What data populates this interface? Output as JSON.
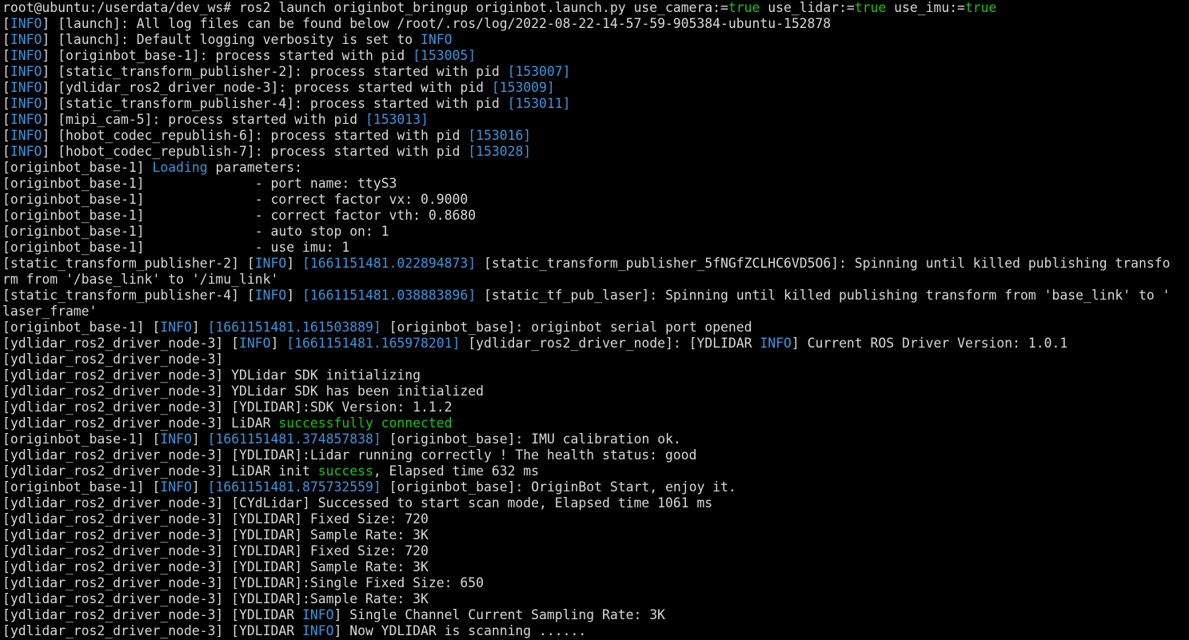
{
  "theme": {
    "background": "#000000",
    "foreground": "#d8d8d8",
    "blue": "#3a96dd",
    "green": "#16c60c"
  },
  "lines": [
    [
      [
        "d",
        "root@ubuntu:/userdata/dev_ws# ros2 launch originbot_bringup originbot.launch.py use_camera:="
      ],
      [
        "g",
        "true"
      ],
      [
        "d",
        " use_lidar:="
      ],
      [
        "g",
        "true"
      ],
      [
        "d",
        " use_imu:="
      ],
      [
        "g",
        "true"
      ]
    ],
    [
      [
        "d",
        "["
      ],
      [
        "b",
        "INFO"
      ],
      [
        "d",
        "] [launch]: All log files can be found below /root/.ros/log/2022-08-22-14-57-59-905384-ubuntu-152878"
      ]
    ],
    [
      [
        "d",
        "["
      ],
      [
        "b",
        "INFO"
      ],
      [
        "d",
        "] [launch]: Default logging verbosity is set to "
      ],
      [
        "b",
        "INFO"
      ]
    ],
    [
      [
        "d",
        "["
      ],
      [
        "b",
        "INFO"
      ],
      [
        "d",
        "] [originbot_base-1]: process started with pid "
      ],
      [
        "b",
        "[153005]"
      ]
    ],
    [
      [
        "d",
        "["
      ],
      [
        "b",
        "INFO"
      ],
      [
        "d",
        "] [static_transform_publisher-2]: process started with pid "
      ],
      [
        "b",
        "[153007]"
      ]
    ],
    [
      [
        "d",
        "["
      ],
      [
        "b",
        "INFO"
      ],
      [
        "d",
        "] [ydlidar_ros2_driver_node-3]: process started with pid "
      ],
      [
        "b",
        "[153009]"
      ]
    ],
    [
      [
        "d",
        "["
      ],
      [
        "b",
        "INFO"
      ],
      [
        "d",
        "] [static_transform_publisher-4]: process started with pid "
      ],
      [
        "b",
        "[153011]"
      ]
    ],
    [
      [
        "d",
        "["
      ],
      [
        "b",
        "INFO"
      ],
      [
        "d",
        "] [mipi_cam-5]: process started with pid "
      ],
      [
        "b",
        "[153013]"
      ]
    ],
    [
      [
        "d",
        "["
      ],
      [
        "b",
        "INFO"
      ],
      [
        "d",
        "] [hobot_codec_republish-6]: process started with pid "
      ],
      [
        "b",
        "[153016]"
      ]
    ],
    [
      [
        "d",
        "["
      ],
      [
        "b",
        "INFO"
      ],
      [
        "d",
        "] [hobot_codec_republish-7]: process started with pid "
      ],
      [
        "b",
        "[153028]"
      ]
    ],
    [
      [
        "d",
        "[originbot_base-1] "
      ],
      [
        "b",
        "Loading"
      ],
      [
        "d",
        " parameters:"
      ]
    ],
    [
      [
        "d",
        "[originbot_base-1]              - port name: ttyS3"
      ]
    ],
    [
      [
        "d",
        "[originbot_base-1]              - correct factor vx: 0.9000"
      ]
    ],
    [
      [
        "d",
        "[originbot_base-1]              - correct factor vth: 0.8680"
      ]
    ],
    [
      [
        "d",
        "[originbot_base-1]              - auto stop on: 1"
      ]
    ],
    [
      [
        "d",
        "[originbot_base-1]              - use imu: 1"
      ]
    ],
    [
      [
        "d",
        "[static_transform_publisher-2] ["
      ],
      [
        "b",
        "INFO"
      ],
      [
        "d",
        "] "
      ],
      [
        "b",
        "[1661151481.022894873]"
      ],
      [
        "d",
        " [static_transform_publisher_5fNGfZCLHC6VD5O6]: Spinning until killed publishing transfo"
      ]
    ],
    [
      [
        "d",
        "rm from '/base_link' to '/imu_link'"
      ]
    ],
    [
      [
        "d",
        "[static_transform_publisher-4] ["
      ],
      [
        "b",
        "INFO"
      ],
      [
        "d",
        "] "
      ],
      [
        "b",
        "[1661151481.038883896]"
      ],
      [
        "d",
        " [static_tf_pub_laser]: Spinning until killed publishing transform from 'base_link' to '"
      ]
    ],
    [
      [
        "d",
        "laser_frame'"
      ]
    ],
    [
      [
        "d",
        "[originbot_base-1] ["
      ],
      [
        "b",
        "INFO"
      ],
      [
        "d",
        "] "
      ],
      [
        "b",
        "[1661151481.161503889]"
      ],
      [
        "d",
        " [originbot_base]: originbot serial port opened"
      ]
    ],
    [
      [
        "d",
        "[ydlidar_ros2_driver_node-3] ["
      ],
      [
        "b",
        "INFO"
      ],
      [
        "d",
        "] "
      ],
      [
        "b",
        "[1661151481.165978201]"
      ],
      [
        "d",
        " [ydlidar_ros2_driver_node]: [YDLIDAR "
      ],
      [
        "b",
        "INFO"
      ],
      [
        "d",
        "] Current ROS Driver Version: 1.0.1"
      ]
    ],
    [
      [
        "d",
        "[ydlidar_ros2_driver_node-3]"
      ]
    ],
    [
      [
        "d",
        "[ydlidar_ros2_driver_node-3] YDLidar SDK initializing"
      ]
    ],
    [
      [
        "d",
        "[ydlidar_ros2_driver_node-3] YDLidar SDK has been initialized"
      ]
    ],
    [
      [
        "d",
        "[ydlidar_ros2_driver_node-3] [YDLIDAR]:SDK Version: 1.1.2"
      ]
    ],
    [
      [
        "d",
        "[ydlidar_ros2_driver_node-3] LiDAR "
      ],
      [
        "g",
        "successfully connected"
      ]
    ],
    [
      [
        "d",
        "[originbot_base-1] ["
      ],
      [
        "b",
        "INFO"
      ],
      [
        "d",
        "] "
      ],
      [
        "b",
        "[1661151481.374857838]"
      ],
      [
        "d",
        " [originbot_base]: IMU calibration ok."
      ]
    ],
    [
      [
        "d",
        "[ydlidar_ros2_driver_node-3] [YDLIDAR]:Lidar running correctly ! The health status: good"
      ]
    ],
    [
      [
        "d",
        "[ydlidar_ros2_driver_node-3] LiDAR init "
      ],
      [
        "g",
        "success"
      ],
      [
        "d",
        ", Elapsed time 632 ms"
      ]
    ],
    [
      [
        "d",
        "[originbot_base-1] ["
      ],
      [
        "b",
        "INFO"
      ],
      [
        "d",
        "] "
      ],
      [
        "b",
        "[1661151481.875732559]"
      ],
      [
        "d",
        " [originbot_base]: OriginBot Start, enjoy it."
      ]
    ],
    [
      [
        "d",
        "[ydlidar_ros2_driver_node-3] [CYdLidar] Successed to start scan mode, Elapsed time 1061 ms"
      ]
    ],
    [
      [
        "d",
        "[ydlidar_ros2_driver_node-3] [YDLIDAR] Fixed Size: 720"
      ]
    ],
    [
      [
        "d",
        "[ydlidar_ros2_driver_node-3] [YDLIDAR] Sample Rate: 3K"
      ]
    ],
    [
      [
        "d",
        "[ydlidar_ros2_driver_node-3] [YDLIDAR] Fixed Size: 720"
      ]
    ],
    [
      [
        "d",
        "[ydlidar_ros2_driver_node-3] [YDLIDAR] Sample Rate: 3K"
      ]
    ],
    [
      [
        "d",
        "[ydlidar_ros2_driver_node-3] [YDLIDAR]:Single Fixed Size: 650"
      ]
    ],
    [
      [
        "d",
        "[ydlidar_ros2_driver_node-3] [YDLIDAR]:Sample Rate: 3K"
      ]
    ],
    [
      [
        "d",
        "[ydlidar_ros2_driver_node-3] [YDLIDAR "
      ],
      [
        "b",
        "INFO"
      ],
      [
        "d",
        "] Single Channel Current Sampling Rate: 3K"
      ]
    ],
    [
      [
        "d",
        "[ydlidar_ros2_driver_node-3] [YDLIDAR "
      ],
      [
        "b",
        "INFO"
      ],
      [
        "d",
        "] Now YDLIDAR is scanning ......"
      ]
    ]
  ]
}
